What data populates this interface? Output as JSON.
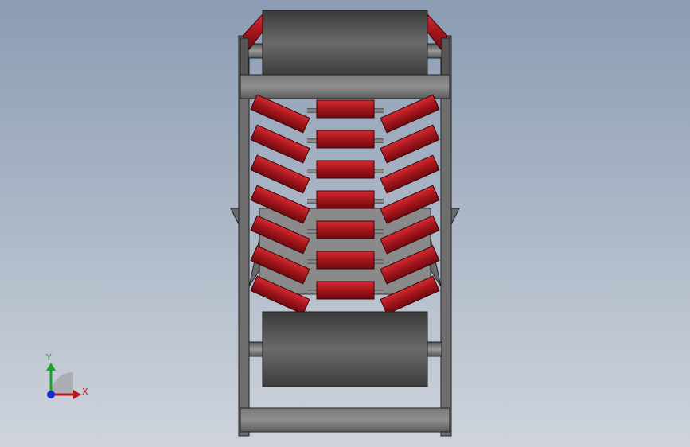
{
  "viewport": {
    "background_top": "#8b9cb3",
    "background_bottom": "#cfd4dc"
  },
  "model": {
    "roller_color": "#a4151c",
    "frame_color": "#6b6b6b",
    "pulley_color": "#4a4a4a",
    "idler_sets": 7
  },
  "triad": {
    "x_label": "X",
    "y_label": "Y",
    "x_color": "#c0161b",
    "y_color": "#1aa32a",
    "z_color": "#1b2ccf"
  }
}
